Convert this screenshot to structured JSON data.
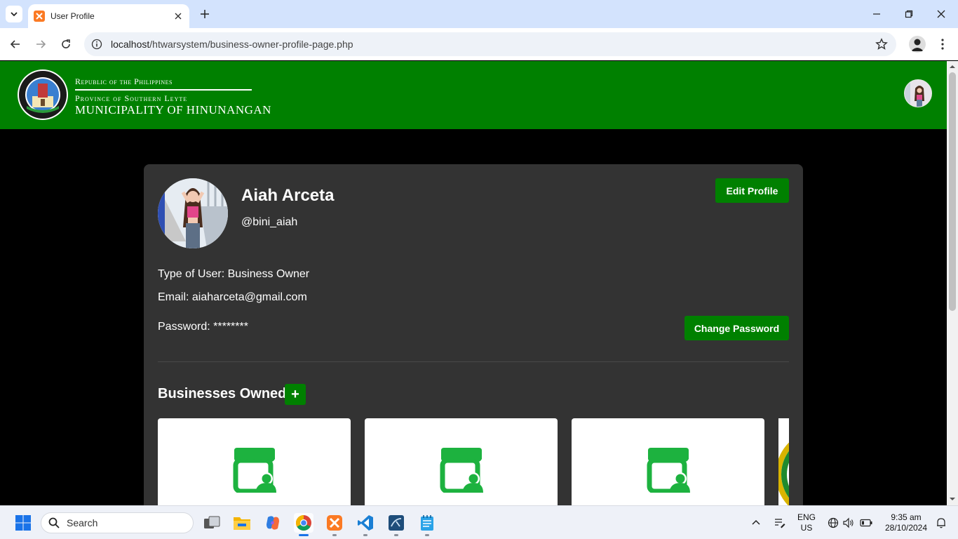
{
  "browser": {
    "tab_title": "User Profile",
    "url_host": "localhost",
    "url_path": "/htwarsystem/business-owner-profile-page.php"
  },
  "header": {
    "line1": "Republic of the Philippines",
    "line2": "Province of Southern Leyte",
    "line3": "MUNICIPALITY OF HINUNANGAN"
  },
  "profile": {
    "name": "Aiah Arceta",
    "handle": "@bini_aiah",
    "edit_label": "Edit Profile",
    "type_line": "Type of User: Business Owner",
    "email_line": "Email: aiaharceta@gmail.com",
    "password_line": "Password: ********",
    "change_password_label": "Change Password"
  },
  "businesses": {
    "title": "Businesses Owned",
    "add_label": "+",
    "cards": [
      {
        "icon": "store-owner-icon"
      },
      {
        "icon": "store-owner-icon"
      },
      {
        "icon": "store-owner-icon"
      },
      {
        "icon": "municipal-seal-image"
      }
    ]
  },
  "taskbar": {
    "search_placeholder": "Search",
    "lang_top": "ENG",
    "lang_bottom": "US",
    "time": "9:35 am",
    "date": "28/10/2024"
  },
  "colors": {
    "brand_green": "#008000",
    "icon_green": "#1db23f",
    "card_bg": "#333333"
  }
}
